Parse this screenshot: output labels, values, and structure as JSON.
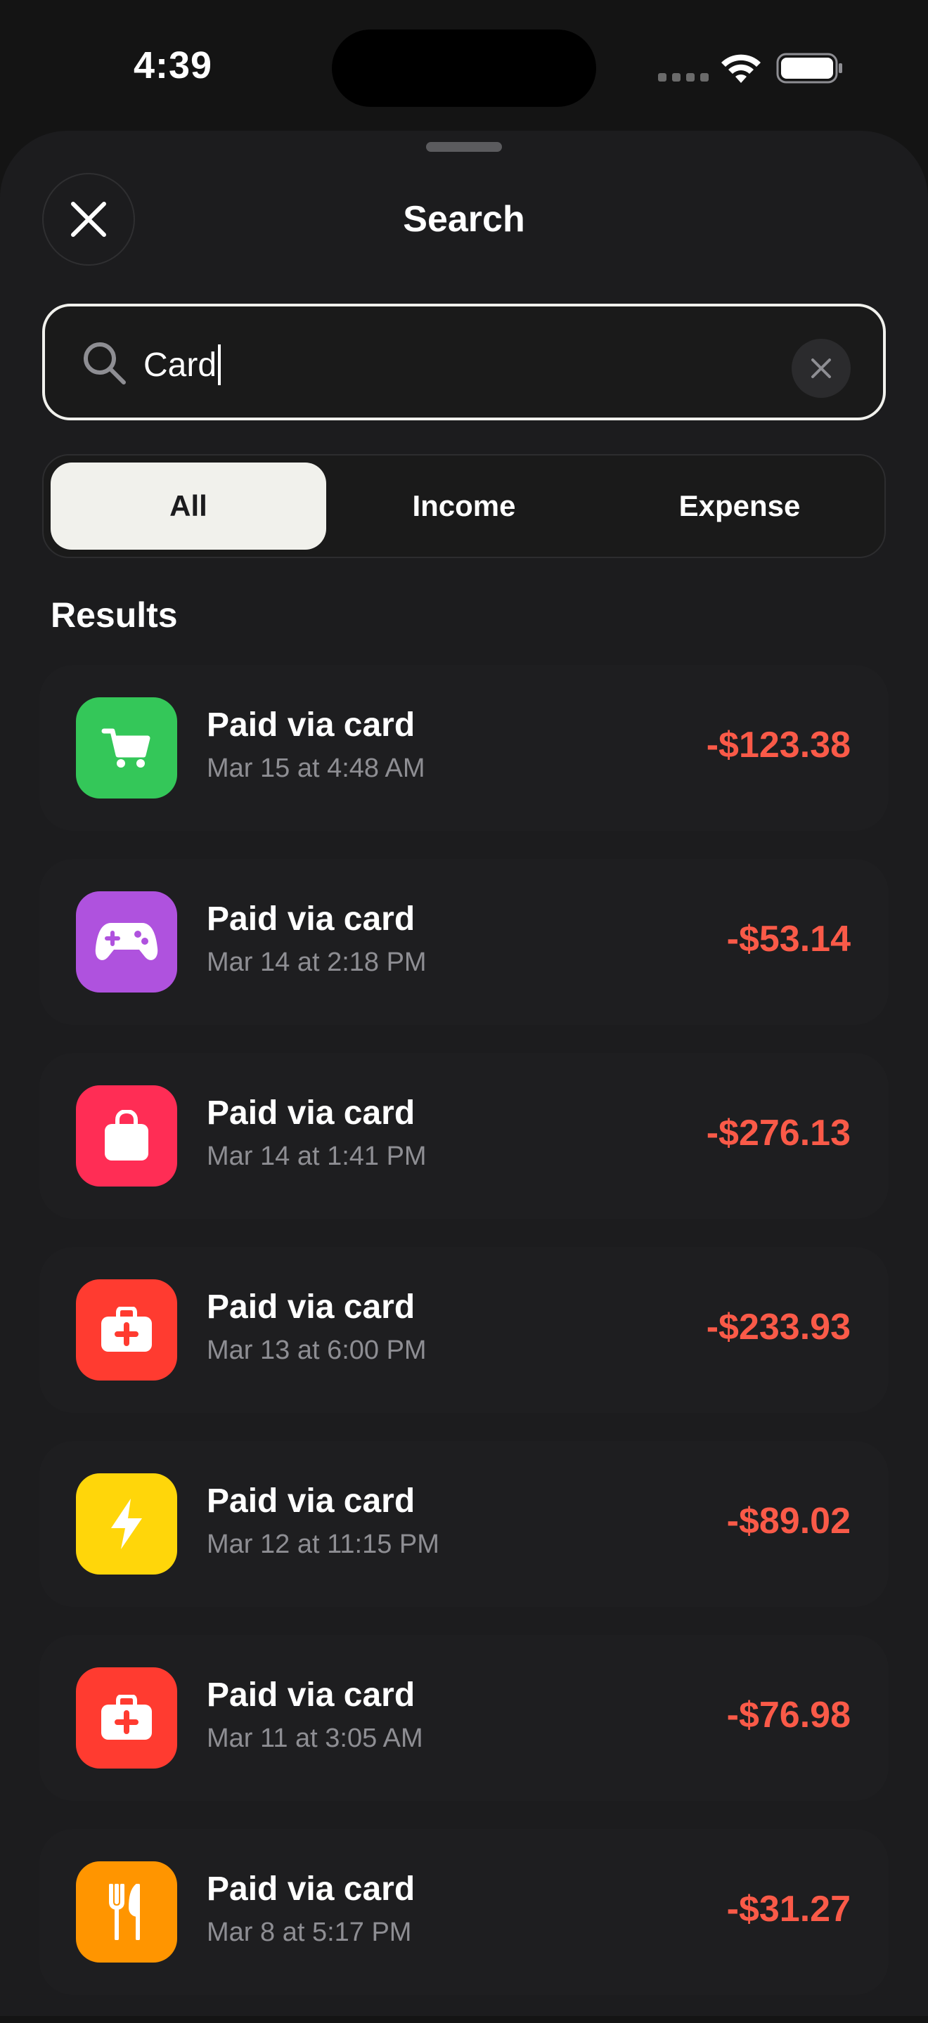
{
  "status_bar": {
    "time": "4:39"
  },
  "sheet": {
    "title": "Search"
  },
  "search": {
    "value": "Card"
  },
  "filters": [
    {
      "label": "All",
      "active": true
    },
    {
      "label": "Income",
      "active": false
    },
    {
      "label": "Expense",
      "active": false
    }
  ],
  "results_label": "Results",
  "results": [
    {
      "title": "Paid via card",
      "date": "Mar 15 at 4:48 AM",
      "amount": "-$123.38",
      "icon": "cart-icon",
      "color": "#34c759"
    },
    {
      "title": "Paid via card",
      "date": "Mar 14 at 2:18 PM",
      "amount": "-$53.14",
      "icon": "gamepad-icon",
      "color": "#af52de"
    },
    {
      "title": "Paid via card",
      "date": "Mar 14 at 1:41 PM",
      "amount": "-$276.13",
      "icon": "shopping-bag-icon",
      "color": "#ff2d55"
    },
    {
      "title": "Paid via card",
      "date": "Mar 13 at 6:00 PM",
      "amount": "-$233.93",
      "icon": "medical-kit-icon",
      "color": "#ff3b30"
    },
    {
      "title": "Paid via card",
      "date": "Mar 12 at 11:15 PM",
      "amount": "-$89.02",
      "icon": "bolt-icon",
      "color": "#ffd60a"
    },
    {
      "title": "Paid via card",
      "date": "Mar 11 at 3:05 AM",
      "amount": "-$76.98",
      "icon": "medical-kit-icon",
      "color": "#ff3b30"
    },
    {
      "title": "Paid via card",
      "date": "Mar 8 at 5:17 PM",
      "amount": "-$31.27",
      "icon": "fork-knife-icon",
      "color": "#ff9500"
    }
  ],
  "colors": {
    "expense": "#fa5a48",
    "sheet_bg": "#1c1c1e",
    "accent_light": "#f1f1ec"
  }
}
